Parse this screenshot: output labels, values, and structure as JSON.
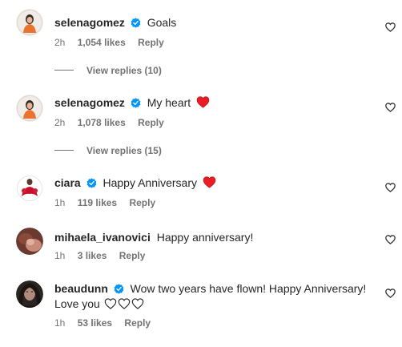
{
  "comments": [
    {
      "username": "selenagomez",
      "verified": true,
      "text": "Goals",
      "time": "2h",
      "likes": "1,054 likes",
      "reply": "Reply",
      "view_replies": "View replies (10)"
    },
    {
      "username": "selenagomez",
      "verified": true,
      "text": "My heart",
      "time": "2h",
      "likes": "1,078 likes",
      "reply": "Reply",
      "view_replies": "View replies (15)"
    },
    {
      "username": "ciara",
      "verified": true,
      "text": "Happy Anniversary",
      "time": "1h",
      "likes": "119 likes",
      "reply": "Reply"
    },
    {
      "username": "mihaela_ivanovici",
      "verified": false,
      "text": "Happy anniversary!",
      "time": "1h",
      "likes": "3 likes",
      "reply": "Reply"
    },
    {
      "username": "beaudunn",
      "verified": true,
      "text": "Wow two years have flown! Happy Anniversary!",
      "text_line2": "Love you",
      "time": "1h",
      "likes": "53 likes",
      "reply": "Reply"
    }
  ],
  "colors": {
    "verified_badge": "#0095f6",
    "red_heart": "#ed1c24",
    "meta_text": "#737373",
    "primary_text": "#262626"
  },
  "icons": {
    "verified": "verified-badge-icon",
    "like": "heart-outline-icon",
    "emoji_red_heart": "red-heart-emoji",
    "emoji_white_heart": "white-heart-emoji"
  }
}
